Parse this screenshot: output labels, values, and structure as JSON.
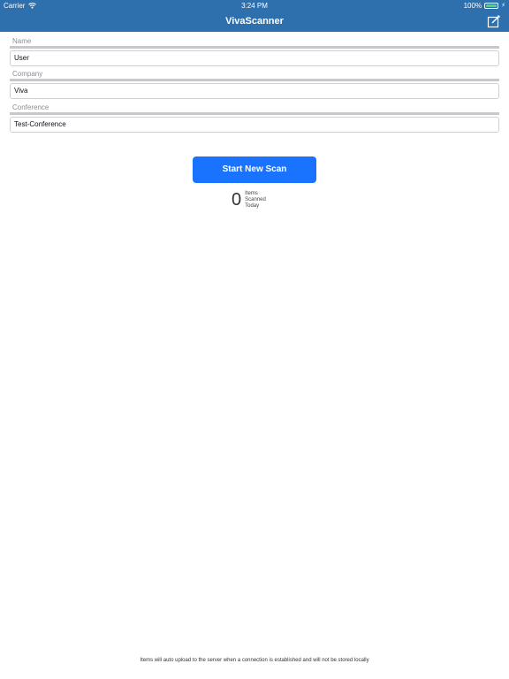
{
  "status_bar": {
    "carrier": "Carrier",
    "time": "3:24 PM",
    "battery_percent": "100%",
    "battery_level": 1.0
  },
  "nav": {
    "title": "VivaScanner",
    "compose_icon": "compose-icon"
  },
  "form": {
    "name": {
      "label": "Name",
      "value": "User"
    },
    "company": {
      "label": "Company",
      "value": "Viva"
    },
    "conference": {
      "label": "Conference",
      "value": "Test-Conference"
    }
  },
  "scan_button": {
    "label": "Start New Scan"
  },
  "counter": {
    "count": "0",
    "line1": "Items",
    "line2": "Scanned",
    "line3": "Today"
  },
  "footer": {
    "text": "Items will auto upload to the server when a connection is established and will not be stored locally"
  },
  "colors": {
    "nav_bg": "#2e6fae",
    "button_bg": "#1a73ff",
    "battery_fill": "#4cd964"
  }
}
